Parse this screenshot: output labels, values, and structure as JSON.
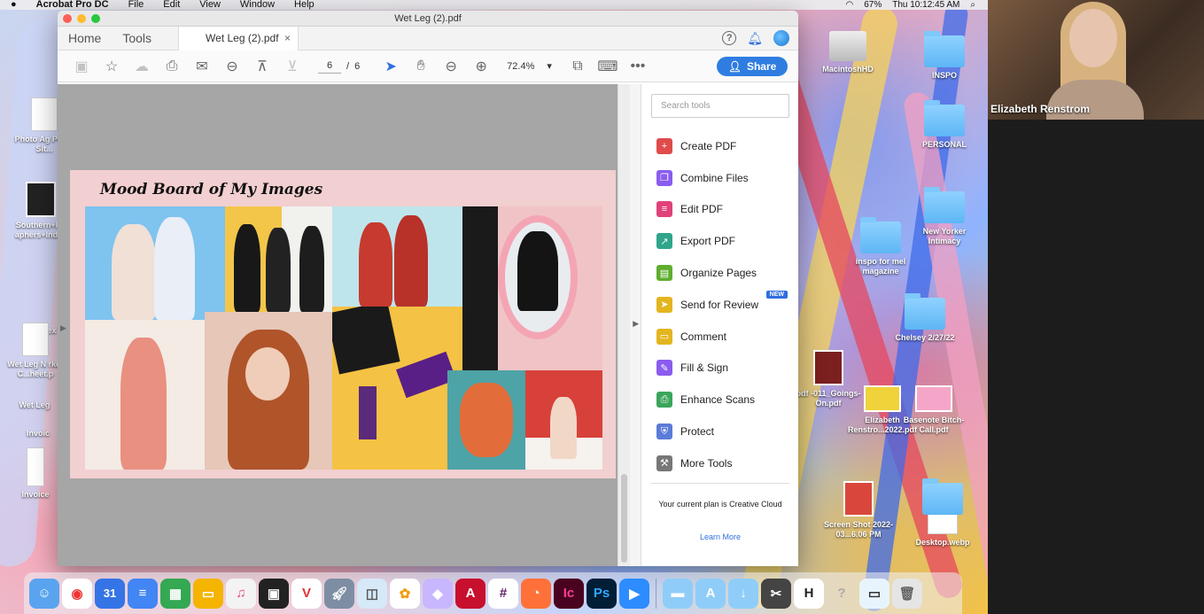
{
  "menubar": {
    "app_name": "Acrobat Pro DC",
    "items": [
      "File",
      "Edit",
      "View",
      "Window",
      "Help"
    ],
    "battery": "67%",
    "clock": "Thu 10:12:45 AM"
  },
  "window": {
    "title": "Wet Leg (2).pdf",
    "tabs": {
      "home": "Home",
      "tools": "Tools",
      "document": "Wet Leg (2).pdf",
      "close": "×"
    }
  },
  "toolbar": {
    "current_page": "6",
    "page_separator": "/",
    "total_pages": "6",
    "zoom": "72.4%",
    "share_label": "Share"
  },
  "document": {
    "page_title": "Mood Board of My Images"
  },
  "tools_pane": {
    "search_placeholder": "Search tools",
    "items": [
      {
        "label": "Create PDF",
        "icon": "create-pdf-icon",
        "color": "#e04b4b"
      },
      {
        "label": "Combine Files",
        "icon": "combine-files-icon",
        "color": "#8a5cf0"
      },
      {
        "label": "Edit PDF",
        "icon": "edit-pdf-icon",
        "color": "#e0417a"
      },
      {
        "label": "Export PDF",
        "icon": "export-pdf-icon",
        "color": "#2fa58a"
      },
      {
        "label": "Organize Pages",
        "icon": "organize-pages-icon",
        "color": "#5fae2e"
      },
      {
        "label": "Send for Review",
        "icon": "send-for-review-icon",
        "color": "#e3b51f",
        "badge": "NEW"
      },
      {
        "label": "Comment",
        "icon": "comment-icon",
        "color": "#e3b51f"
      },
      {
        "label": "Fill & Sign",
        "icon": "fill-sign-icon",
        "color": "#8a5cf0"
      },
      {
        "label": "Enhance Scans",
        "icon": "enhance-scans-icon",
        "color": "#3aa65b"
      },
      {
        "label": "Protect",
        "icon": "protect-icon",
        "color": "#5a7bd8"
      },
      {
        "label": "More Tools",
        "icon": "more-tools-icon",
        "color": "#777777"
      }
    ],
    "plan_text": "Your current plan is Creative Cloud",
    "learn_more": "Learn More"
  },
  "desktop_icons": {
    "macintosh_hd": "MacintoshHD",
    "inspo": "INSPO",
    "personal": "PERSONAL",
    "new_yorker": "New Yorker Intimacy",
    "inspo_mel": "inspo for mel magazine",
    "chelsey": "Chelsey 2/27/22",
    "goings_on": "pdf -011_Goings-On.pdf",
    "elizabeth": "Elizabeth Renstro...2022.pdf",
    "basenote": "Basenote Bitch-Call.pdf",
    "screenshot": "Screen Shot 2022-03...6.06 PM",
    "desktop_webp": "Desktop.webp",
    "photo_agency": "Photo Ag Press Sit...",
    "southern": "Southern+Ph aphers+Index",
    "wet_leg_n": "Wet Leg N rker C...heet.p",
    "wet_leg": "Wet Leg",
    "invoice1": "Invoic",
    "invoice2": "Invoice",
    "alex": "Alex"
  },
  "video": {
    "participant_name": "Elizabeth Renstrom"
  },
  "colors": {
    "accent": "#2f7de1",
    "page_bg": "#f2cfd0",
    "doc_bg": "#a6a6a6"
  }
}
